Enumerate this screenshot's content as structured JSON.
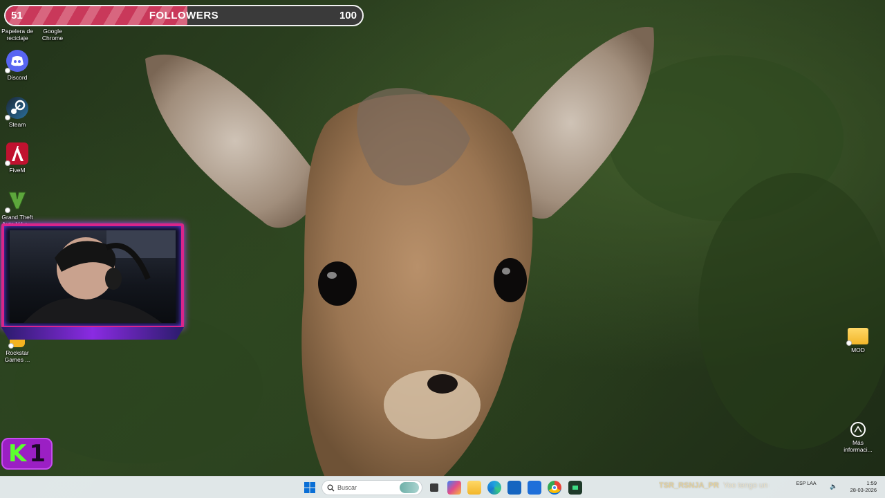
{
  "followers": {
    "current": "51",
    "title": "FOLLOWERS",
    "goal": "100",
    "progress": 0.51
  },
  "desktop_icons": [
    {
      "label": "Papelera de reciclaje",
      "icon": "recycle-bin-icon"
    },
    {
      "label": "Google Chrome",
      "icon": "chrome-icon"
    },
    {
      "label": "Discord",
      "icon": "discord-icon"
    },
    {
      "label": "Steam",
      "icon": "steam-icon"
    },
    {
      "label": "FiveM",
      "icon": "fivem-icon"
    },
    {
      "label": "Grand Theft Auto V Le...",
      "icon": "gta-v-icon"
    },
    {
      "label": "Rockstar Games ...",
      "icon": "rockstar-launcher-icon"
    },
    {
      "label": "MOD",
      "icon": "folder-icon"
    },
    {
      "label": "Más informaci...",
      "icon": "learn-more-icon"
    }
  ],
  "overlay_badge": {
    "letter": "K",
    "number": "1"
  },
  "taskbar": {
    "search_placeholder": "Buscar",
    "apps": [
      "start-icon",
      "game-icon",
      "file-explorer-icon",
      "copilot-icon",
      "folder-icon",
      "edge-icon",
      "store-icon",
      "outlook-icon",
      "chrome-icon",
      "app-icon"
    ],
    "ticker_user": "TSR_RSNJA_PR",
    "ticker_text": "Yoo tengo un encanto",
    "language": "ESP LAA",
    "time": "1:59",
    "date": "28-03-2026"
  },
  "colors": {
    "followers_fill": "#c9385a",
    "cam_border": "#d9258a",
    "badge_bg": "#9b1fc4",
    "badge_k": "#5cff2e"
  }
}
